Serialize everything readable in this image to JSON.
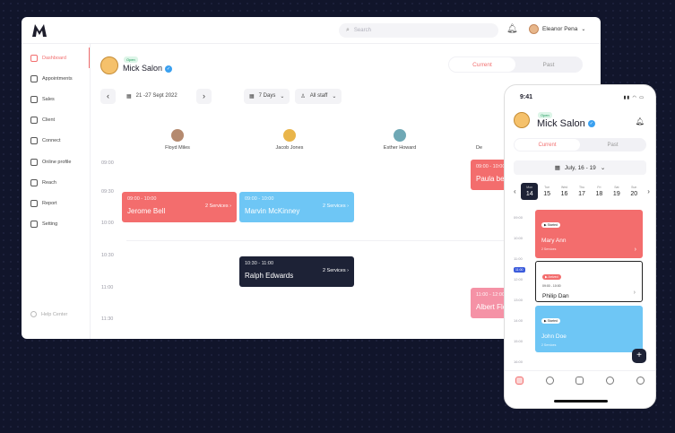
{
  "topbar": {
    "search_placeholder": "Search",
    "user_name": "Eleanor Pena"
  },
  "sidebar": {
    "items": [
      {
        "label": "Dashboard",
        "icon": "dashboard-icon"
      },
      {
        "label": "Appointments",
        "icon": "calendar-icon"
      },
      {
        "label": "Sales",
        "icon": "chart-icon"
      },
      {
        "label": "Client",
        "icon": "user-icon"
      },
      {
        "label": "Connect",
        "icon": "chat-icon"
      },
      {
        "label": "Online profile",
        "icon": "monitor-icon"
      },
      {
        "label": "Reach",
        "icon": "megaphone-icon"
      },
      {
        "label": "Report",
        "icon": "report-icon"
      },
      {
        "label": "Setting",
        "icon": "gear-icon"
      }
    ],
    "help": "Help Center",
    "active": "Dashboard"
  },
  "header": {
    "open_badge": "Open",
    "salon_name": "Mick Salon",
    "tabs": [
      "Current",
      "Past"
    ]
  },
  "controls": {
    "date_range": "21 -27 Sept 2022",
    "view": "7 Days",
    "staff": "All staff"
  },
  "staff": [
    "Floyd Miles",
    "Jacob Jones",
    "Esther Howard",
    "De"
  ],
  "times": [
    "09:00",
    "09:30",
    "10:00",
    "10:30",
    "11:00",
    "11:30"
  ],
  "appointments": [
    {
      "time": "09:00 - 10:00",
      "name": "Jerome Bell",
      "services": "2 Services",
      "color": "#f36d6d"
    },
    {
      "time": "09:00 - 10:00",
      "name": "Marvin McKinney",
      "services": "2 Services",
      "color": "#6ec6f5"
    },
    {
      "time": "10:30 - 11:00",
      "name": "Ralph Edwards",
      "services": "2 Services",
      "color": "#1d2236"
    },
    {
      "time": "09:00 - 10:00",
      "name": "Paula bell",
      "services": "",
      "color": "#f36d6d"
    },
    {
      "time": "11:00 - 12:00",
      "name": "Albert Flo",
      "services": "",
      "color": "#f592a6"
    }
  ],
  "mobile": {
    "clock": "9:41",
    "open_badge": "Open",
    "salon_name": "Mick Salon",
    "tabs": [
      "Current",
      "Past"
    ],
    "date": "July, 16 - 19",
    "days": [
      {
        "d": "Mon",
        "n": "14"
      },
      {
        "d": "Tue",
        "n": "15"
      },
      {
        "d": "Wed",
        "n": "16"
      },
      {
        "d": "Thu",
        "n": "17"
      },
      {
        "d": "Fri",
        "n": "18"
      },
      {
        "d": "Sat",
        "n": "19"
      },
      {
        "d": "Sun",
        "n": "20"
      }
    ],
    "times": [
      "09:00",
      "10:00",
      "11:00",
      "12:00",
      "13:00",
      "14:00",
      "15:00",
      "16:00",
      "17:00",
      "18:00"
    ],
    "now_tag": "11:00",
    "cards": [
      {
        "badge": "Started",
        "name": "Mary Ann",
        "sub": "2 Services",
        "color": "#f36d6d"
      },
      {
        "badge": "Arrived",
        "time": "09:00 - 10:00",
        "name": "Philip Dan",
        "color": "#ffffff"
      },
      {
        "badge": "Started",
        "name": "John Doe",
        "sub": "2 Services",
        "color": "#6ec6f5"
      }
    ]
  }
}
